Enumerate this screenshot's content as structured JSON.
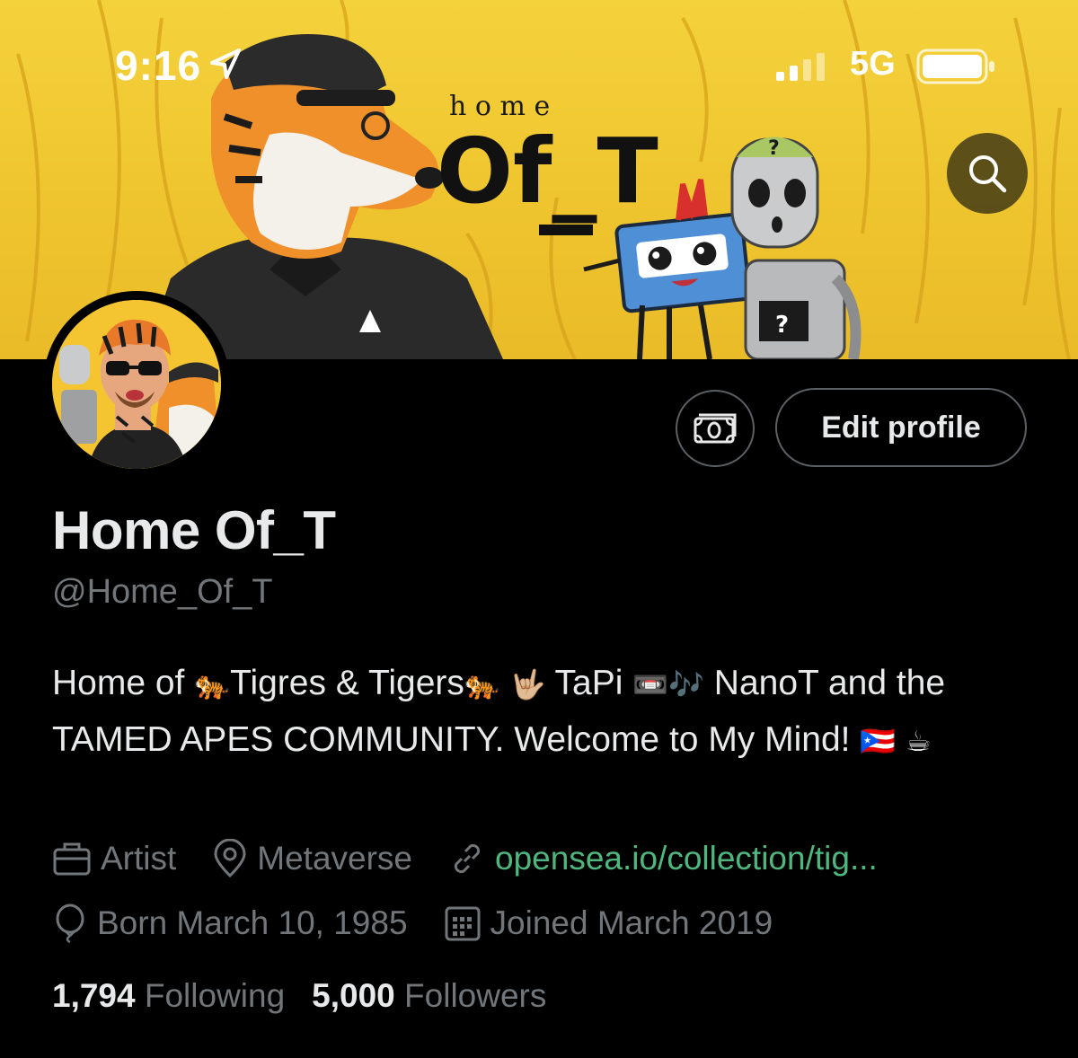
{
  "status_bar": {
    "time": "9:16",
    "network": "5G",
    "icons": [
      "location-arrow-icon",
      "signal-bars-icon",
      "battery-icon"
    ]
  },
  "banner": {
    "logo_top": "h o m e",
    "logo_main": "Of_T"
  },
  "actions": {
    "edit_profile_label": "Edit profile"
  },
  "profile": {
    "display_name": "Home Of_T",
    "handle": "@Home_Of_T",
    "bio": {
      "part1": "Home of ",
      "emoji_tiger1": "🐅",
      "part2": "Tigres & Tigers",
      "emoji_tiger2": "🐅",
      "emoji_hand": "🤟🏼",
      "part3": " TaPi ",
      "emoji_tape": "📼",
      "emoji_notes": "🎶",
      "part4": " NanoT and the TAMED APES COMMUNITY. Welcome to My Mind! ",
      "emoji_flag": "🇵🇷",
      "emoji_coffee": "☕"
    },
    "category": "Artist",
    "location": "Metaverse",
    "website": "opensea.io/collection/tig...",
    "birthday": "Born March 10, 1985",
    "joined": "Joined March 2019"
  },
  "stats": {
    "following_count": "1,794",
    "following_label": "Following",
    "followers_count": "5,000",
    "followers_label": "Followers"
  },
  "colors": {
    "banner_yellow": "#f4d23c",
    "link_green": "#4fb77e",
    "muted_text": "#71767b",
    "primary_text": "#e7e9ea"
  }
}
